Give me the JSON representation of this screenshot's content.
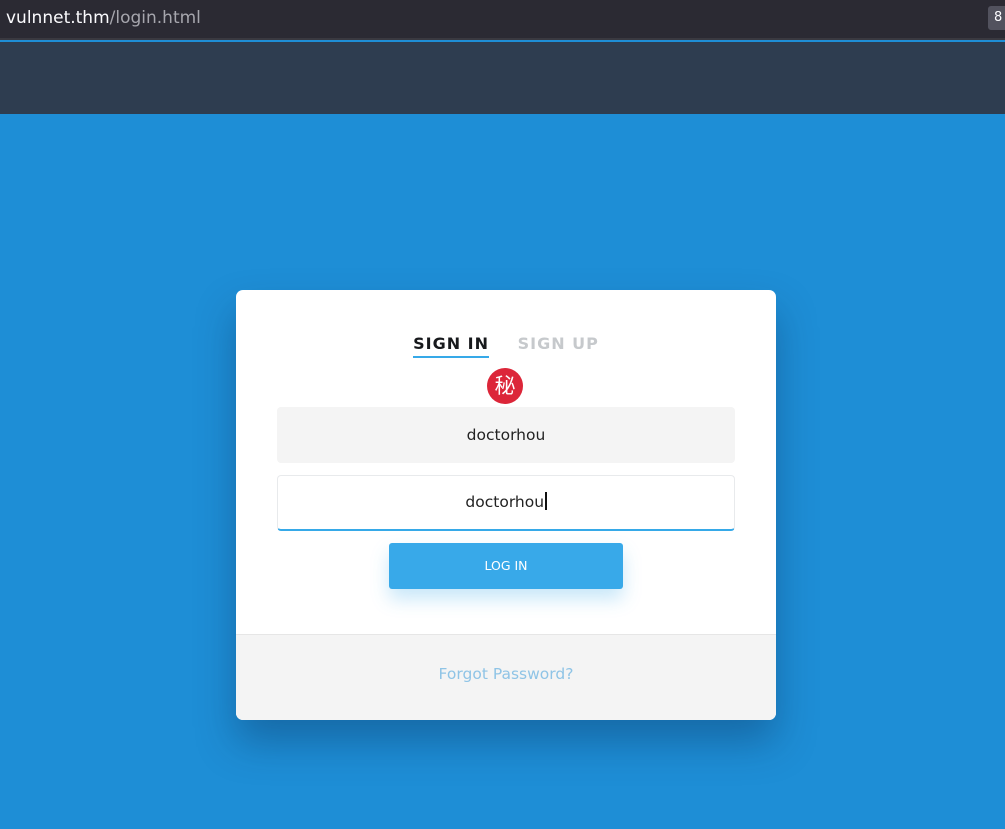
{
  "browser": {
    "url_host": "vulnnet.thm",
    "url_path": "/login.html",
    "badge_text": "8"
  },
  "login": {
    "tabs": [
      {
        "label": "SIGN IN",
        "active": true
      },
      {
        "label": "SIGN UP",
        "active": false
      }
    ],
    "logo_glyph": "秘",
    "username_value": "doctorhou",
    "password_value": "doctorhou",
    "submit_label": "LOG IN",
    "forgot_link": "Forgot Password?"
  },
  "colors": {
    "page_background": "#1e8ed6",
    "nav_background": "#2e3d50",
    "accent": "#38a9e9",
    "logo_red": "#dc2639",
    "forgot_link": "#8fc4e6"
  }
}
